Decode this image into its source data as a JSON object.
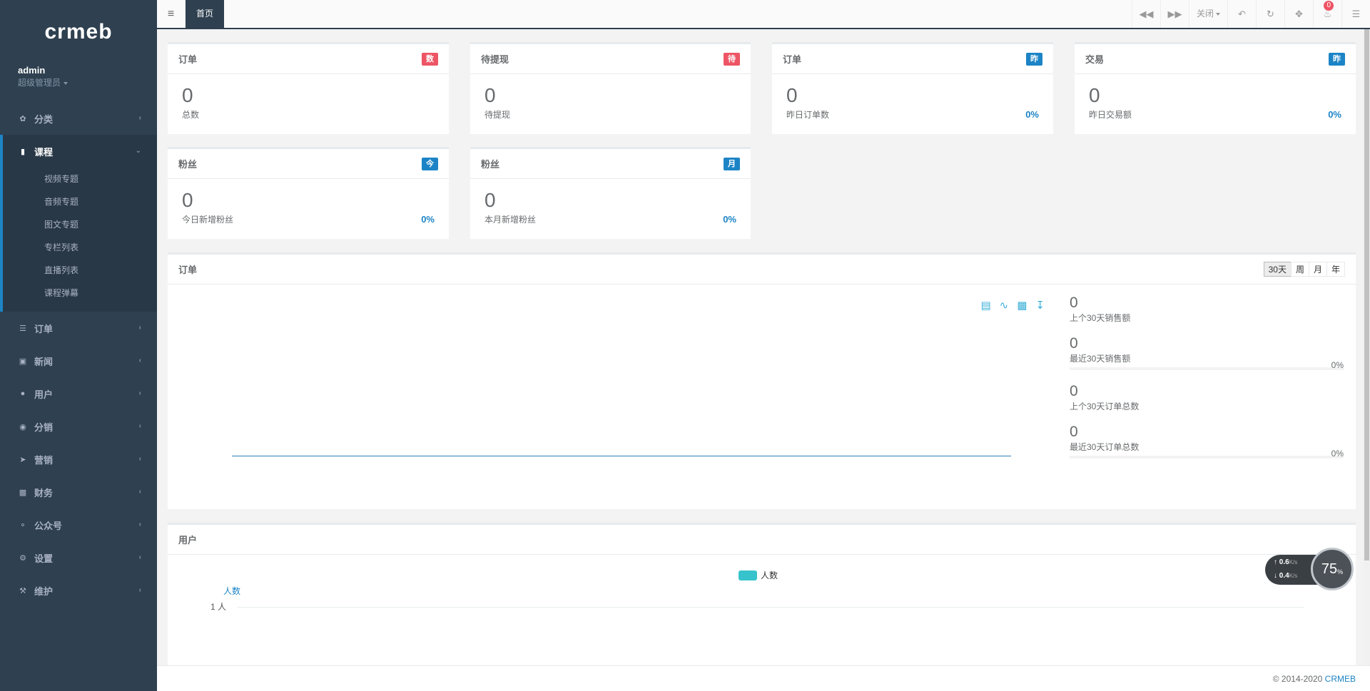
{
  "brand": "crmeb",
  "user": {
    "name": "admin",
    "role": "超级管理员"
  },
  "menu": [
    {
      "label": "分类",
      "icon": "leaf-icon"
    },
    {
      "label": "课程",
      "icon": "book-icon",
      "active": true,
      "sub": [
        "视频专题",
        "音频专题",
        "图文专题",
        "专栏列表",
        "直播列表",
        "课程弹幕"
      ]
    },
    {
      "label": "订单",
      "icon": "list-icon"
    },
    {
      "label": "新闻",
      "icon": "image-icon"
    },
    {
      "label": "用户",
      "icon": "user-icon"
    },
    {
      "label": "分销",
      "icon": "users-icon"
    },
    {
      "label": "营销",
      "icon": "send-icon"
    },
    {
      "label": "财务",
      "icon": "money-icon"
    },
    {
      "label": "公众号",
      "icon": "wechat-icon"
    },
    {
      "label": "设置",
      "icon": "gear-icon"
    },
    {
      "label": "维护",
      "icon": "wrench-icon"
    }
  ],
  "topbar": {
    "tab": "首页",
    "close": "关闭",
    "notifications": "0"
  },
  "cards": [
    {
      "title": "订单",
      "badge": "数",
      "badge_color": "#ed5565",
      "value": "0",
      "desc": "总数"
    },
    {
      "title": "待提现",
      "badge": "待",
      "badge_color": "#ed5565",
      "value": "0",
      "desc": "待提现"
    },
    {
      "title": "订单",
      "badge": "昨",
      "badge_color": "#1c84c6",
      "value": "0",
      "desc": "昨日订单数",
      "pct": "0%"
    },
    {
      "title": "交易",
      "badge": "昨",
      "badge_color": "#1c84c6",
      "value": "0",
      "desc": "昨日交易额",
      "pct": "0%"
    },
    {
      "title": "粉丝",
      "badge": "今",
      "badge_color": "#1c84c6",
      "value": "0",
      "desc": "今日新增粉丝",
      "pct": "0%"
    },
    {
      "title": "粉丝",
      "badge": "月",
      "badge_color": "#1c84c6",
      "value": "0",
      "desc": "本月新增粉丝",
      "pct": "0%"
    }
  ],
  "order_panel": {
    "title": "订单",
    "ranges": [
      "30天",
      "周",
      "月",
      "年"
    ],
    "stats": [
      {
        "value": "0",
        "label": "上个30天销售额"
      },
      {
        "value": "0",
        "label": "最近30天销售额",
        "pct": "0%"
      },
      {
        "value": "0",
        "label": "上个30天订单总数"
      },
      {
        "value": "0",
        "label": "最近30天订单总数",
        "pct": "0%"
      }
    ]
  },
  "user_panel": {
    "title": "用户",
    "legend": "人数",
    "y_title": "人数",
    "y_tick": "1 人"
  },
  "speed": {
    "up": "0.6",
    "down": "0.4",
    "unit": "K/s",
    "percent": "75",
    "pct_sign": "%"
  },
  "footer": {
    "copyright": "© 2014-2020 ",
    "brand": "CRMEB"
  },
  "colors": {
    "sidebar": "#2f4050",
    "accent": "#1c84c6",
    "danger": "#ed5565",
    "chart": "#36c3cb"
  }
}
